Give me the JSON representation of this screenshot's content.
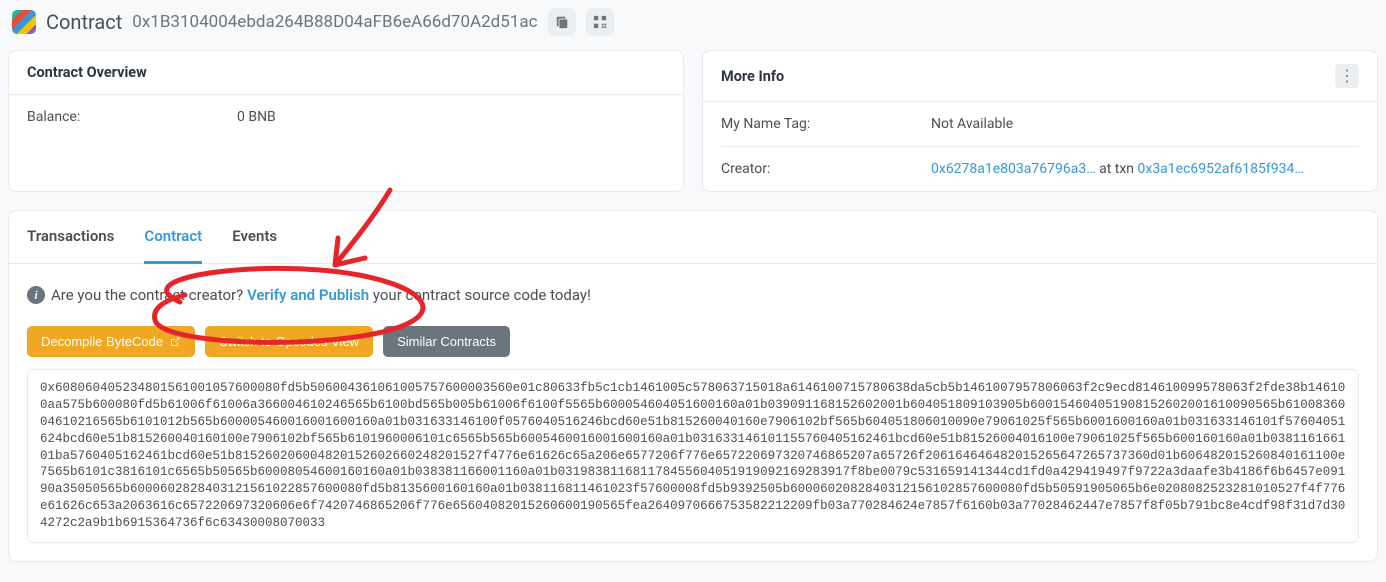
{
  "header": {
    "title_label": "Contract",
    "address": "0x1B3104004ebda264B88D04aFB6eA66d70A2d51ac"
  },
  "overview": {
    "title": "Contract Overview",
    "balance_label": "Balance:",
    "balance_value": "0 BNB"
  },
  "more_info": {
    "title": "More Info",
    "name_tag_label": "My Name Tag:",
    "name_tag_value": "Not Available",
    "creator_label": "Creator:",
    "creator_link": "0x6278a1e803a76796a3…",
    "at_txn": " at txn ",
    "txn_link": "0x3a1ec6952af6185f934…"
  },
  "tabs": {
    "items": [
      "Transactions",
      "Contract",
      "Events"
    ],
    "active_index": 1
  },
  "verify_prompt": {
    "prefix": "Are you the contract creator? ",
    "link": "Verify and Publish",
    "suffix": " your contract source code today!"
  },
  "buttons": {
    "decompile": "Decompile ByteCode",
    "opcodes": "Switch to Opcodes View",
    "similar": "Similar Contracts"
  },
  "bytecode": "0x608060405234801561001057600080fd5b506004361061005757600003560e01c80633fb5c1cb1461005c578063715018a6146100715780638da5cb5b1461007957806063f2c9ecd814610099578063f2fde38b146100aa575b600080fd5b61006f61006a366004610246565b6100bd565b005b61006f6100f5565b600054604051600160a01b039091168152602001b604051809103905b600154604051908152602001610090565b6100836004610216565b6101012b565b600005460016001600160a01b031633146100f0576040516246bcd60e51b815260040160e7906102bf565b604051806010090e79061025f565b6001600160a01b031633146101f57604051624bcd60e51b815260040160100e7906102bf565b6101960006101c6565b565b6005460016001600160a01b031633146101155760405162461bcd60e51b81526004016100e79061025f565b600160160a01b038116166101ba5760405162461bcd60e51b815260206004820152602660248201527f4776e61626c65a206e6577206f776e657220697320746865207a65726f206164646482015265647265737360d01b606482015260840161100e7565b6101c3816101c6565b50565b60008054600160160a01b038381166001160a01b031983811681178455604051919092169283917f8be0079c531659141344cd1fd0a429419497f9722a3daafe3b4186f6b6457e09190a35050565b6000602828403121561022857600080fd5b8135600160160a01b038116811461023f57600008fd5b9392505b6000602082840312156102857600080fd5b50591905065b6e0208082523281010527f4f776e61626c653a2063616c657220697320606e6f7420746865206f776e65604082015260600190565fea2640970666753582212209fb03a770284624e7857f6160b03a77028462447e7857f8f05b791bc8e4cdf98f31d7d304272c2a9b1b6915364736f6c63430008070033"
}
